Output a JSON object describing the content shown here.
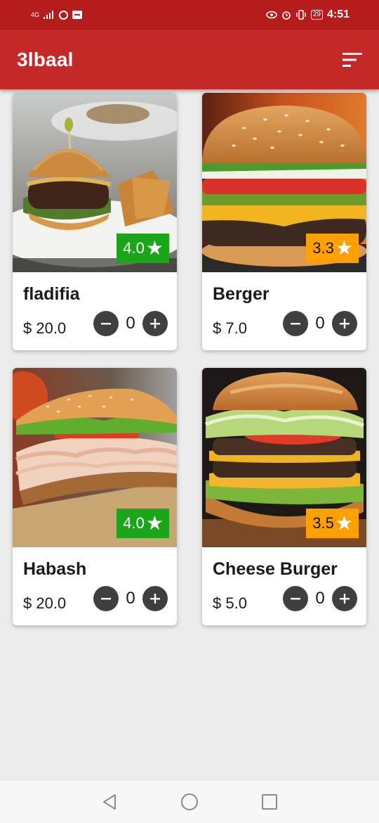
{
  "status_bar": {
    "network": "4G",
    "battery": "29",
    "time": "4:51"
  },
  "app": {
    "title": "3lbaal",
    "menu_icon": "filter-list-icon"
  },
  "currency_symbol": "$",
  "items": [
    {
      "name": "fladifia",
      "price": "$ 20.0",
      "rating": "4.0",
      "rating_color": "#1aa51a",
      "quantity": "0"
    },
    {
      "name": "Berger",
      "price": "$ 7.0",
      "rating": "3.3",
      "rating_color": "#ffa000",
      "quantity": "0"
    },
    {
      "name": "Habash",
      "price": "$ 20.0",
      "rating": "4.0",
      "rating_color": "#1aa51a",
      "quantity": "0"
    },
    {
      "name": "Cheese Burger",
      "price": "$ 5.0",
      "rating": "3.5",
      "rating_color": "#ffa000",
      "quantity": "0"
    }
  ],
  "colors": {
    "app_bar": "#c62828",
    "status_bar": "#b71c1c",
    "background": "#ececec"
  },
  "nav": {
    "back_icon": "back-triangle-icon",
    "home_icon": "home-circle-icon",
    "recents_icon": "recents-square-icon"
  }
}
